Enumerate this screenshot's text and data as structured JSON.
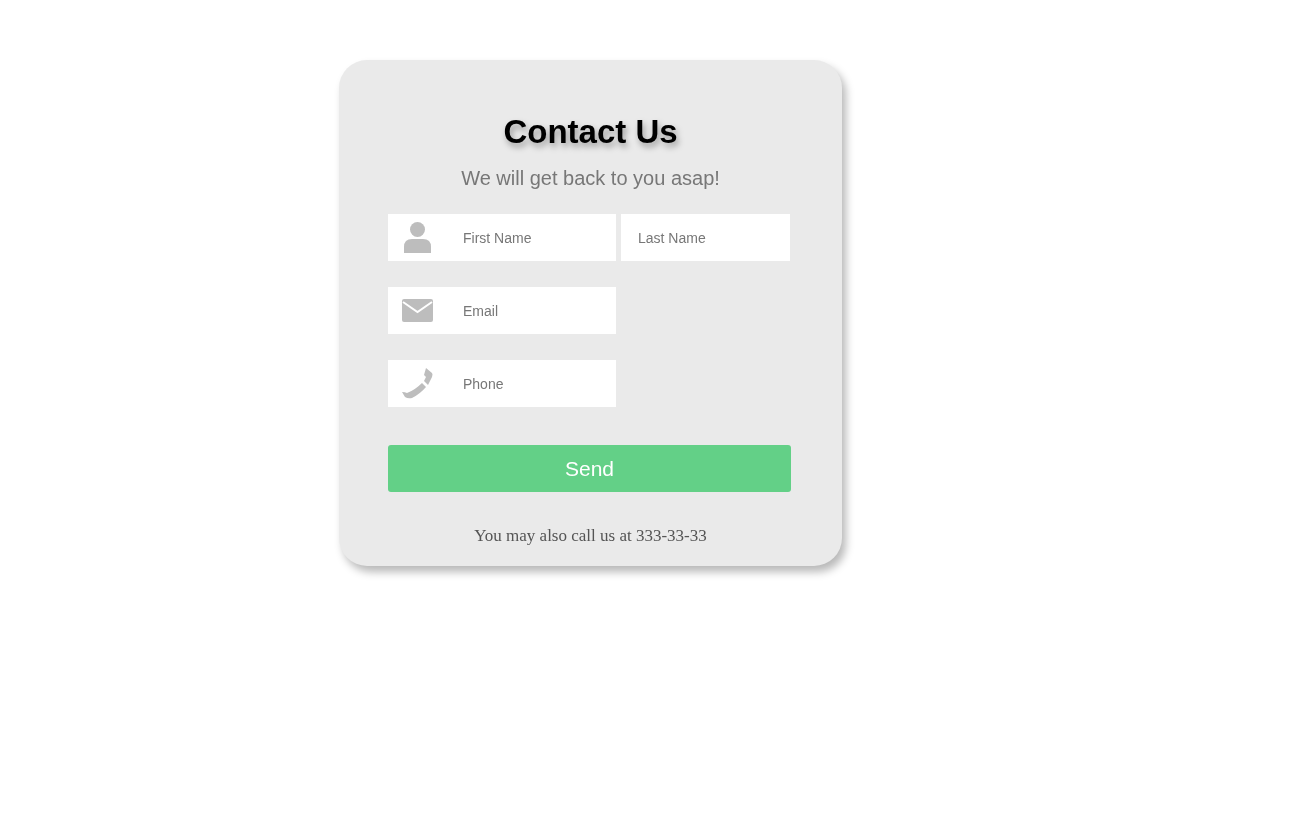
{
  "title": "Contact Us",
  "subtitle": "We will get back to you asap!",
  "field_rows": [
    {
      "fields": [
        {
          "kind": "name",
          "placeholder": "First Name",
          "icon": true
        },
        {
          "kind": "name",
          "placeholder": "Last Name",
          "icon": false
        }
      ]
    },
    {
      "fields": [
        {
          "kind": "email",
          "placeholder": "Email",
          "icon": true
        }
      ]
    },
    {
      "fields": [
        {
          "kind": "phone",
          "placeholder": "Phone",
          "icon": true
        }
      ]
    }
  ],
  "send_button": "Send",
  "footer": "You may also call us at 333-33-33"
}
